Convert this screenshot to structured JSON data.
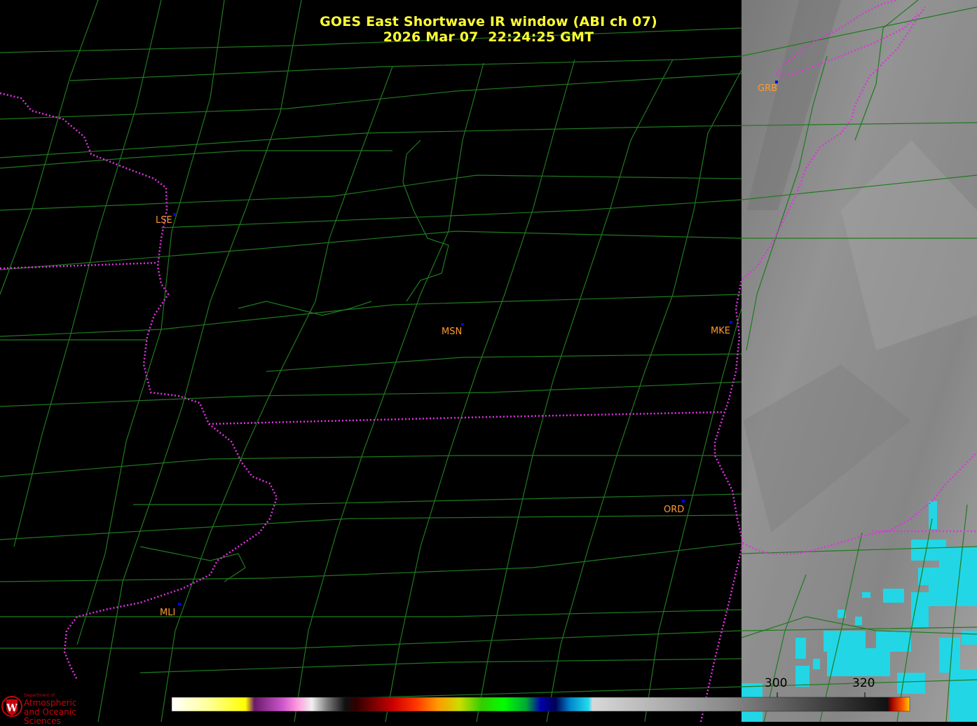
{
  "title": {
    "line1": "GOES East Shortwave IR window (ABI ch 07)",
    "line2": "2026 Mar 07  22:24:25 GMT"
  },
  "stations": [
    {
      "code": "GRB",
      "name": "GRB"
    },
    {
      "code": "LSE",
      "name": "LSE"
    },
    {
      "code": "MSN",
      "name": "MSN"
    },
    {
      "code": "MKE",
      "name": "MKE"
    },
    {
      "code": "ORD",
      "name": "ORD"
    },
    {
      "code": "MLI",
      "name": "MLI"
    }
  ],
  "colorbar": {
    "tick_labels": [
      "300",
      "320"
    ]
  },
  "logo": {
    "dept_line": "Department of",
    "line1": "Atmospheric",
    "line2": "and Oceanic Sciences",
    "seal_letter": "W"
  },
  "colors": {
    "title": "#ffff33",
    "county_lines": "#1f7a1f",
    "state_lines": "#e033e0",
    "station_label": "#ff9a2e",
    "station_dot": "#0000ff",
    "lake_gray": "#8a8a8a",
    "cold_cloud": "#22d6e6",
    "logo_red": "#c5050c"
  },
  "legend": {
    "colormap": "Shortwave IR temperature enhancement"
  }
}
